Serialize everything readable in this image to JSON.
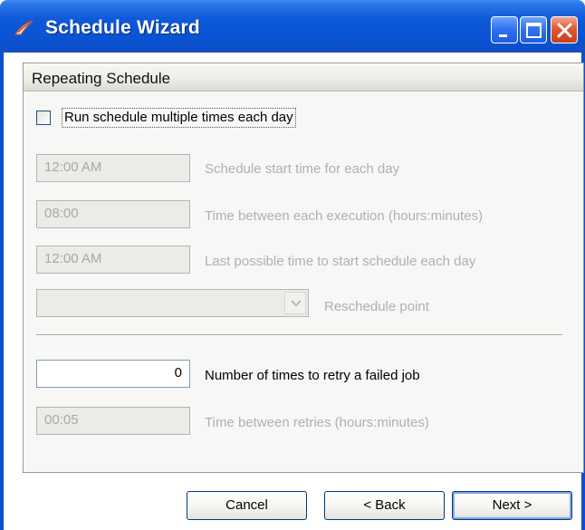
{
  "window": {
    "title": "Schedule Wizard",
    "title_icon": "scheduler-app-icon",
    "controls": [
      "minimize-icon",
      "maximize-icon",
      "close-icon"
    ]
  },
  "panel": {
    "title": "Repeating Schedule"
  },
  "repeat": {
    "checkbox_label": "Run schedule multiple times each day",
    "checked": false
  },
  "fields": {
    "start_time": {
      "value": "12:00 AM",
      "label": "Schedule start time for each day"
    },
    "interval": {
      "value": "08:00",
      "label": "Time between each execution (hours:minutes)"
    },
    "last_time": {
      "value": "12:00 AM",
      "label": "Last possible time to start schedule each day"
    },
    "reschedule": {
      "value": "",
      "label": "Reschedule point"
    },
    "retry_count": {
      "value": "0",
      "label": "Number of times to retry a failed job"
    },
    "retry_interval": {
      "value": "00:05",
      "label": "Time between retries (hours:minutes)"
    }
  },
  "buttons": {
    "cancel": "Cancel",
    "back": "< Back",
    "next": "Next >"
  },
  "colors": {
    "titlebar": "#0b50cc",
    "close_button": "#e05a35",
    "disabled_text": "#a8a8a8"
  }
}
